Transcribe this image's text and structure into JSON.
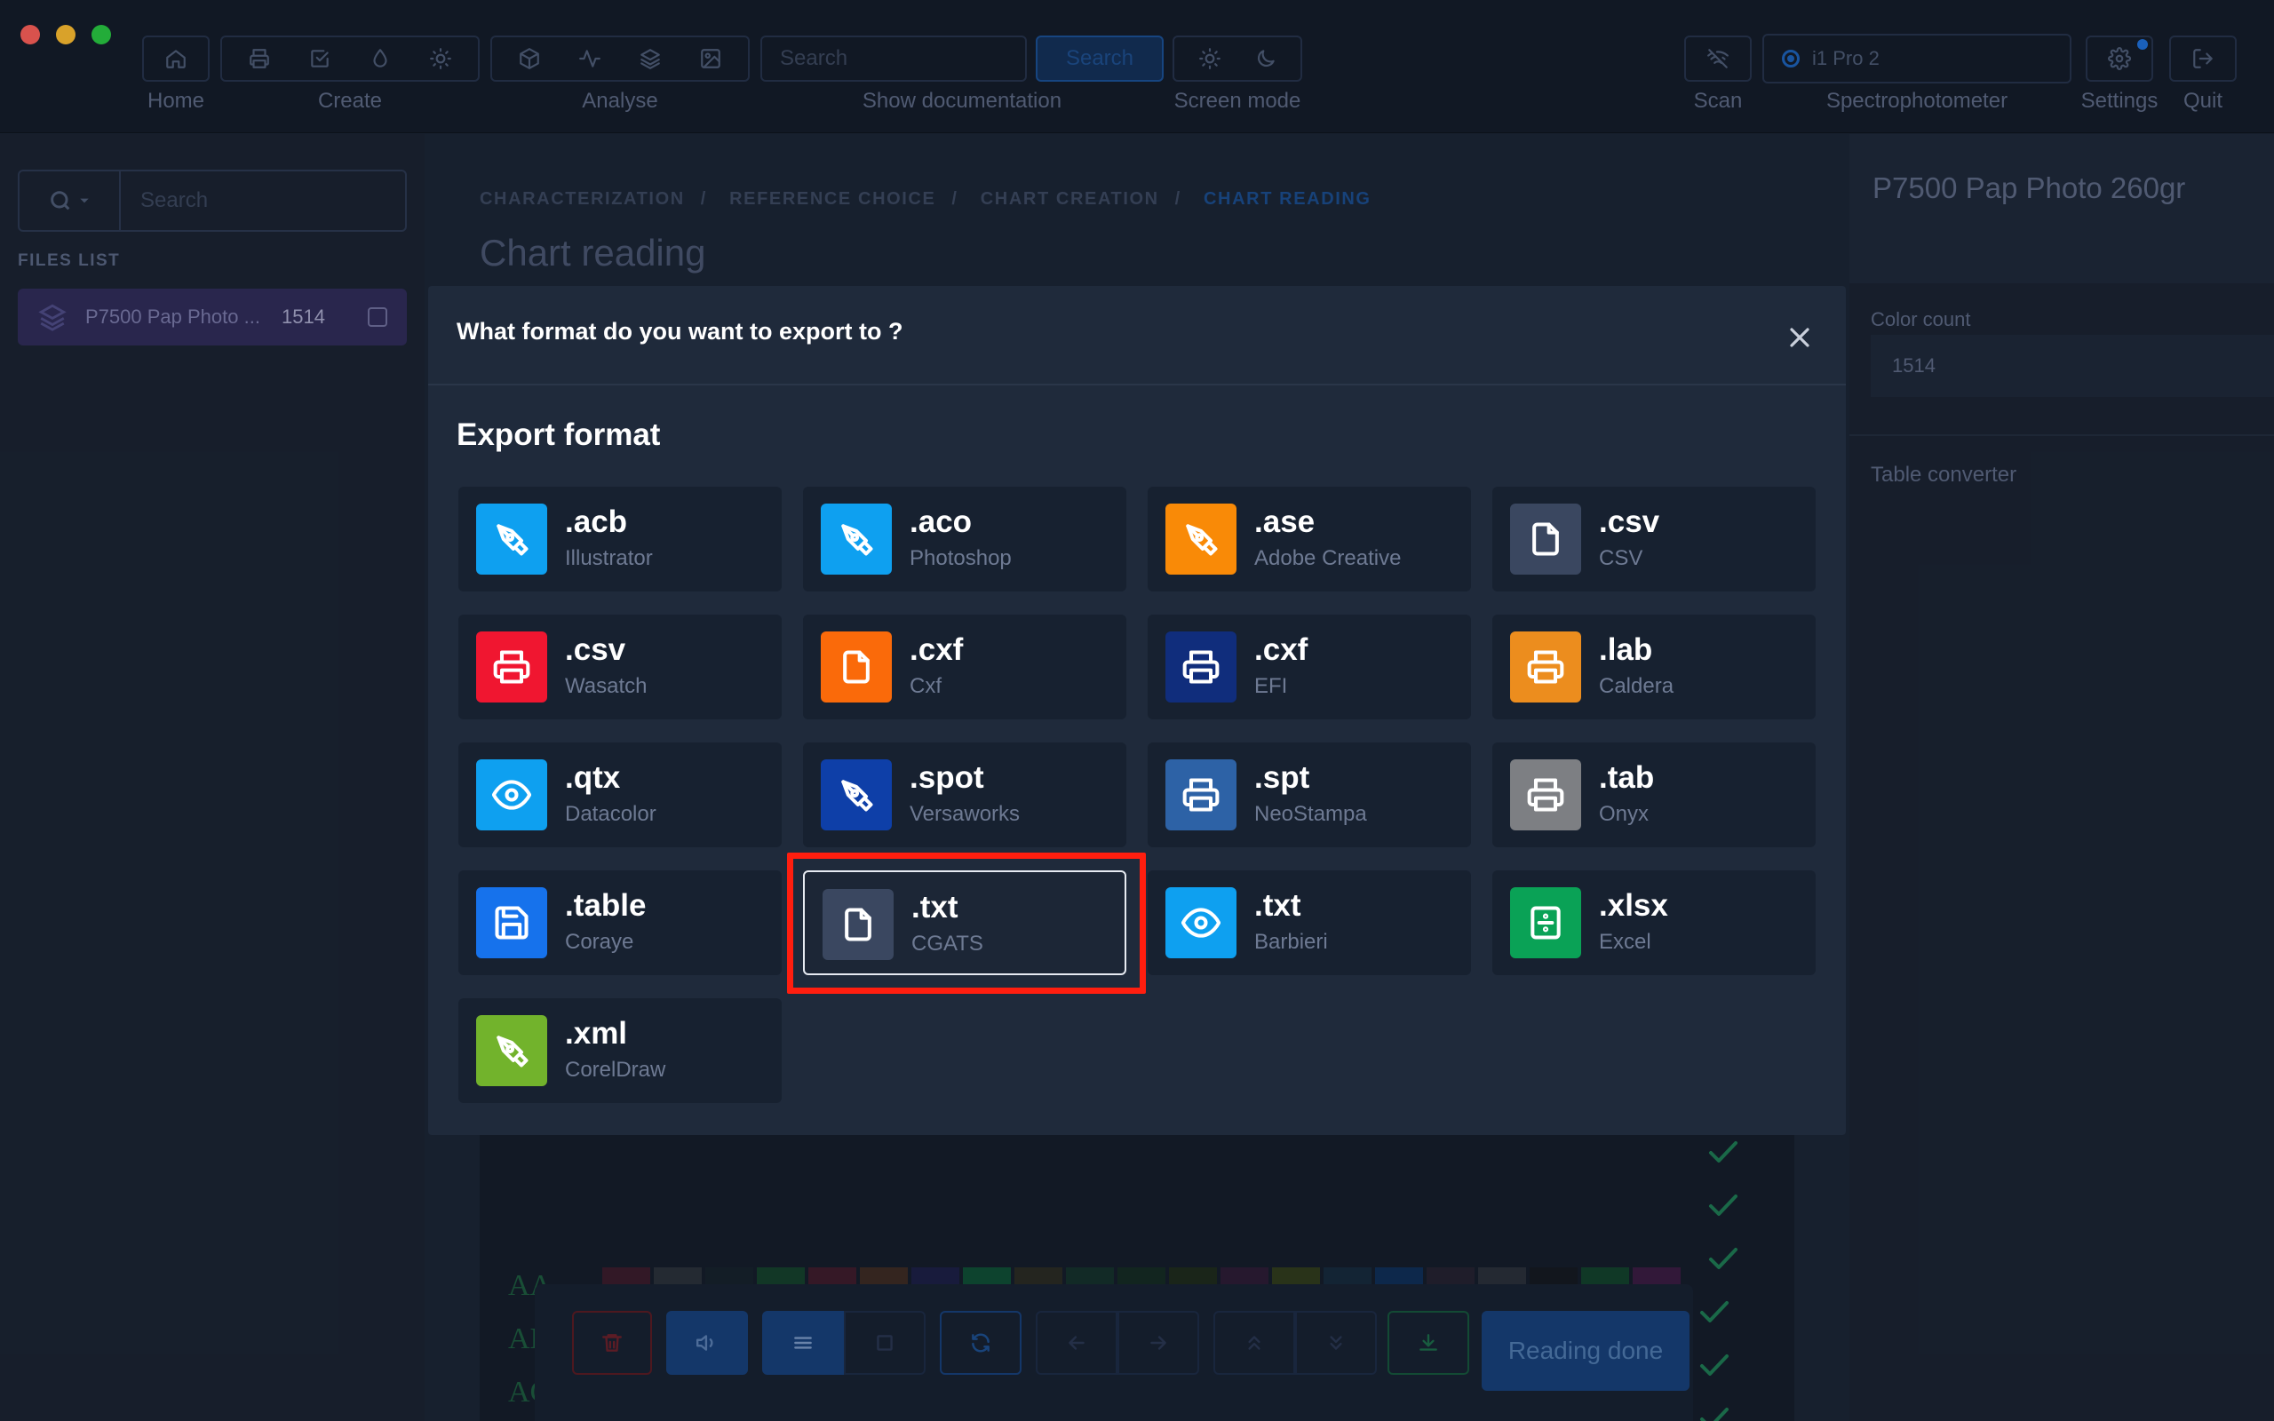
{
  "toolbar": {
    "labels": {
      "home": "Home",
      "create": "Create",
      "analyse": "Analyse",
      "show_doc": "Show documentation",
      "screen_mode": "Screen mode",
      "scan": "Scan",
      "spectro": "Spectrophotometer",
      "settings": "Settings",
      "quit": "Quit"
    },
    "search_placeholder": "Search",
    "search_button": "Search",
    "spectro_device": "i1 Pro 2"
  },
  "sidebar": {
    "search_placeholder": "Search",
    "files_title": "FILES LIST",
    "files": [
      {
        "name": "P7500 Pap Photo ...",
        "count": "1514"
      }
    ]
  },
  "main": {
    "breadcrumbs": [
      "CHARACTERIZATION",
      "REFERENCE CHOICE",
      "CHART CREATION",
      "CHART READING"
    ],
    "title": "Chart reading",
    "rows": [
      "AA",
      "AB",
      "AC"
    ],
    "reading_done": "Reading done"
  },
  "right_panel": {
    "title": "P7500 Pap Photo 260gr",
    "color_count_label": "Color count",
    "color_count_value": "1514",
    "table_converter": "Table converter"
  },
  "modal": {
    "title": "What format do you want to export to ?",
    "section": "Export format",
    "selected": ".txt CGATS",
    "formats": [
      {
        "ext": ".acb",
        "name": "Illustrator",
        "color": "#0ea0f0",
        "icon": "pen-icon"
      },
      {
        "ext": ".aco",
        "name": "Photoshop",
        "color": "#0ea0f0",
        "icon": "pen-icon"
      },
      {
        "ext": ".ase",
        "name": "Adobe Creative",
        "color": "#f98a07",
        "icon": "pen-icon"
      },
      {
        "ext": ".csv",
        "name": "CSV",
        "color": "#3a4760",
        "icon": "file-icon"
      },
      {
        "ext": ".csv",
        "name": "Wasatch",
        "color": "#f01630",
        "icon": "printer-icon"
      },
      {
        "ext": ".cxf",
        "name": "Cxf",
        "color": "#fa6a0a",
        "icon": "file-icon"
      },
      {
        "ext": ".cxf",
        "name": "EFI",
        "color": "#102d7c",
        "icon": "printer-icon"
      },
      {
        "ext": ".lab",
        "name": "Caldera",
        "color": "#ec8d1e",
        "icon": "printer-icon"
      },
      {
        "ext": ".qtx",
        "name": "Datacolor",
        "color": "#0ea0f0",
        "icon": "eye-icon"
      },
      {
        "ext": ".spot",
        "name": "Versaworks",
        "color": "#0e3fa8",
        "icon": "pen-icon"
      },
      {
        "ext": ".spt",
        "name": "NeoStampa",
        "color": "#2d62a6",
        "icon": "printer-icon"
      },
      {
        "ext": ".tab",
        "name": "Onyx",
        "color": "#7d7f83",
        "icon": "printer-icon"
      },
      {
        "ext": ".table",
        "name": "Coraye",
        "color": "#1672ec",
        "icon": "save-icon"
      },
      {
        "ext": ".txt",
        "name": "CGATS",
        "color": "#3a4760",
        "icon": "file-icon"
      },
      {
        "ext": ".txt",
        "name": "Barbieri",
        "color": "#0ea0f0",
        "icon": "eye-icon"
      },
      {
        "ext": ".xlsx",
        "name": "Excel",
        "color": "#0aa256",
        "icon": "spreadsheet-icon"
      },
      {
        "ext": ".xml",
        "name": "CorelDraw",
        "color": "#72b32c",
        "icon": "pen-icon"
      }
    ]
  }
}
